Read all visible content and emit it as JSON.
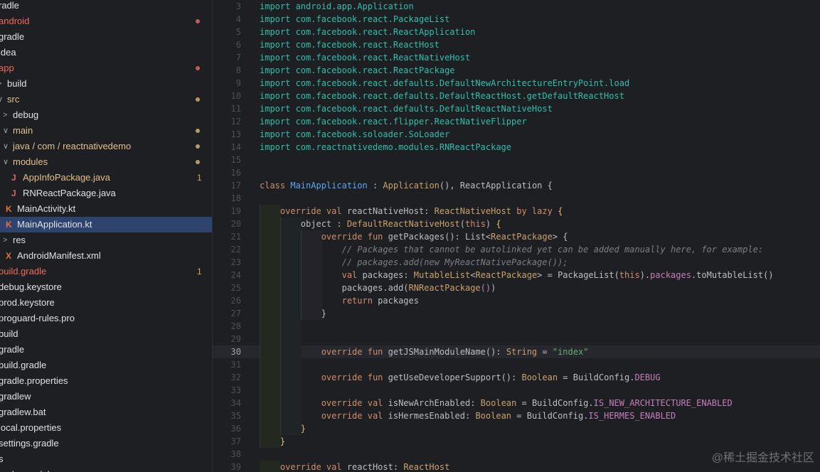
{
  "colors": {
    "kw": "#cf8e6d",
    "cls": "#bcbec4",
    "def": "#56a8f5",
    "str": "#6aab73",
    "cmt": "#7a7e85",
    "con": "#c77dbb",
    "typ": "#c9a26d",
    "imp": "#2fbfae",
    "purple": "#9876aa",
    "fld": "#c77dbb",
    "mod": "#58a6ff",
    "br": "#e8bf6a",
    "red": "#ee6a5f",
    "yellow": "#e2c08d",
    "white": "#dfe1e5",
    "dot_red": "#c55a5a",
    "dot_yellow": "#b79a5e"
  },
  "sidebar": {
    "items": [
      {
        "label": "radle",
        "chevron": "",
        "icon": "",
        "indent": 0,
        "color": "white"
      },
      {
        "label": "android",
        "chevron": "",
        "icon": "",
        "indent": 0,
        "color": "red",
        "dot": "dot_red"
      },
      {
        "label": "gradle",
        "chevron": "",
        "icon": "",
        "indent": 0,
        "color": "white"
      },
      {
        "label": "idea",
        "chevron": "",
        "icon": "",
        "indent": 0,
        "color": "white"
      },
      {
        "label": "app",
        "chevron": "",
        "icon": "",
        "indent": 0,
        "color": "red",
        "dot": "dot_red"
      },
      {
        "label": "build",
        "chevron": ">",
        "icon": "",
        "indent": 0,
        "color": "white"
      },
      {
        "label": "src",
        "chevron": "∨",
        "icon": "",
        "indent": 0,
        "color": "yellow",
        "dot": "dot_yellow"
      },
      {
        "label": "debug",
        "chevron": ">",
        "icon": "",
        "indent": 1,
        "color": "white"
      },
      {
        "label": "main",
        "chevron": "∨",
        "icon": "",
        "indent": 1,
        "color": "yellow",
        "dot": "dot_yellow"
      },
      {
        "label": "java / com / reactnativedemo",
        "chevron": "∨",
        "icon": "",
        "indent": 1,
        "color": "yellow",
        "dot": "dot_yellow"
      },
      {
        "label": "modules",
        "chevron": "∨",
        "icon": "",
        "indent": 1,
        "color": "yellow",
        "dot": "dot_yellow"
      },
      {
        "label": "AppInfoPackage.java",
        "chevron": "",
        "icon": "J",
        "indent": 2,
        "color": "yellow",
        "count": "1"
      },
      {
        "label": "RNReactPackage.java",
        "chevron": "",
        "icon": "J",
        "indent": 2,
        "color": "white"
      },
      {
        "label": "MainActivity.kt",
        "chevron": "",
        "icon": "K",
        "indent": 1,
        "color": "white"
      },
      {
        "label": "MainApplication.kt",
        "chevron": "",
        "icon": "K",
        "indent": 1,
        "color": "white",
        "selected": true
      },
      {
        "label": "res",
        "chevron": ">",
        "icon": "",
        "indent": 1,
        "color": "white"
      },
      {
        "label": "AndroidManifest.xml",
        "chevron": "",
        "icon": "X",
        "indent": 1,
        "color": "white"
      },
      {
        "label": "build.gradle",
        "chevron": "",
        "icon": "",
        "indent": 0,
        "color": "red",
        "count": "1"
      },
      {
        "label": "debug.keystore",
        "chevron": "",
        "icon": "",
        "indent": 0,
        "color": "white"
      },
      {
        "label": "prod.keystore",
        "chevron": "",
        "icon": "",
        "indent": 0,
        "color": "white"
      },
      {
        "label": "proguard-rules.pro",
        "chevron": "",
        "icon": "",
        "indent": 0,
        "color": "white"
      },
      {
        "label": "build",
        "chevron": "",
        "icon": "",
        "indent": 0,
        "color": "white"
      },
      {
        "label": "gradle",
        "chevron": "",
        "icon": "",
        "indent": 0,
        "color": "white"
      },
      {
        "label": "build.gradle",
        "chevron": "",
        "icon": "",
        "indent": 0,
        "color": "white"
      },
      {
        "label": "gradle.properties",
        "chevron": "",
        "icon": "",
        "indent": 0,
        "color": "white"
      },
      {
        "label": "gradlew",
        "chevron": "",
        "icon": "",
        "indent": 0,
        "color": "white"
      },
      {
        "label": "gradlew.bat",
        "chevron": "",
        "icon": "",
        "indent": 0,
        "color": "white"
      },
      {
        "label": "local.properties",
        "chevron": "",
        "icon": "",
        "indent": 0,
        "color": "white"
      },
      {
        "label": "settings.gradle",
        "chevron": "",
        "icon": "",
        "indent": 0,
        "color": "white"
      },
      {
        "label": "s",
        "chevron": "",
        "icon": "",
        "indent": 0,
        "color": "white"
      },
      {
        "label": "node_modules",
        "chevron": "",
        "icon": "",
        "indent": 0,
        "color": "white"
      }
    ]
  },
  "editor": {
    "current_line": 30,
    "lines": [
      {
        "n": 3,
        "segs": [
          [
            "import android.app.Application",
            "imp"
          ]
        ]
      },
      {
        "n": 4,
        "segs": [
          [
            "import com.facebook.react.PackageList",
            "imp"
          ]
        ]
      },
      {
        "n": 5,
        "segs": [
          [
            "import com.facebook.react.ReactApplication",
            "imp"
          ]
        ]
      },
      {
        "n": 6,
        "segs": [
          [
            "import com.facebook.react.ReactHost",
            "imp"
          ]
        ]
      },
      {
        "n": 7,
        "segs": [
          [
            "import com.facebook.react.ReactNativeHost",
            "imp"
          ]
        ]
      },
      {
        "n": 8,
        "segs": [
          [
            "import com.facebook.react.ReactPackage",
            "imp"
          ]
        ]
      },
      {
        "n": 9,
        "segs": [
          [
            "import com.facebook.react.defaults.DefaultNewArchitectureEntryPoint.load",
            "imp"
          ]
        ]
      },
      {
        "n": 10,
        "segs": [
          [
            "import com.facebook.react.defaults.DefaultReactHost.getDefaultReactHost",
            "imp"
          ]
        ]
      },
      {
        "n": 11,
        "segs": [
          [
            "import com.facebook.react.defaults.DefaultReactNativeHost",
            "imp"
          ]
        ]
      },
      {
        "n": 12,
        "segs": [
          [
            "import com.facebook.react.flipper.ReactNativeFlipper",
            "imp"
          ]
        ]
      },
      {
        "n": 13,
        "segs": [
          [
            "import com.facebook.soloader.SoLoader",
            "imp"
          ]
        ]
      },
      {
        "n": 14,
        "segs": [
          [
            "import com.reactnativedemo.modules.RNReactPackage",
            "imp"
          ]
        ]
      },
      {
        "n": 15,
        "segs": []
      },
      {
        "n": 16,
        "segs": []
      },
      {
        "n": 17,
        "segs": [
          [
            "class ",
            "kw"
          ],
          [
            "MainApplication",
            "def"
          ],
          [
            " : ",
            "cls"
          ],
          [
            "Application",
            "typ"
          ],
          [
            "(), ",
            "cls"
          ],
          [
            "ReactApplication",
            "cls"
          ],
          [
            " {",
            "cls"
          ]
        ]
      },
      {
        "n": 18,
        "segs": []
      },
      {
        "n": 19,
        "segs": [
          [
            "    override val ",
            "kw"
          ],
          [
            "reactNativeHost",
            "cls"
          ],
          [
            ": ",
            "cls"
          ],
          [
            "ReactNativeHost",
            "typ"
          ],
          [
            " by lazy ",
            "kw"
          ],
          [
            "{",
            "br"
          ]
        ]
      },
      {
        "n": 20,
        "segs": [
          [
            "        object : ",
            "cls"
          ],
          [
            "DefaultReactNativeHost",
            "typ"
          ],
          [
            "(",
            "cls"
          ],
          [
            "this",
            "kw"
          ],
          [
            ") ",
            "cls"
          ],
          [
            "{",
            "br"
          ]
        ]
      },
      {
        "n": 21,
        "segs": [
          [
            "            override fun ",
            "kw"
          ],
          [
            "getPackages",
            "cls"
          ],
          [
            "(): ",
            "cls"
          ],
          [
            "List",
            "cls"
          ],
          [
            "<",
            "cls"
          ],
          [
            "ReactPackage",
            "typ"
          ],
          [
            "> {",
            "cls"
          ]
        ]
      },
      {
        "n": 22,
        "segs": [
          [
            "                // Packages that cannot be autolinked yet can be added manually here, for example:",
            "cmt"
          ]
        ]
      },
      {
        "n": 23,
        "segs": [
          [
            "                // packages.add(new MyReactNativePackage());",
            "cmt"
          ]
        ]
      },
      {
        "n": 24,
        "segs": [
          [
            "                val ",
            "kw"
          ],
          [
            "packages",
            "cls"
          ],
          [
            ": ",
            "cls"
          ],
          [
            "MutableList",
            "typ"
          ],
          [
            "<",
            "cls"
          ],
          [
            "ReactPackage",
            "typ"
          ],
          [
            "> = ",
            "cls"
          ],
          [
            "PackageList",
            "cls"
          ],
          [
            "(",
            "cls"
          ],
          [
            "this",
            "kw"
          ],
          [
            ").",
            "cls"
          ],
          [
            "packages",
            "fld"
          ],
          [
            ".toMutableList()",
            "cls"
          ]
        ]
      },
      {
        "n": 25,
        "segs": [
          [
            "                packages.add(",
            "cls"
          ],
          [
            "RNReactPackage",
            "typ"
          ],
          [
            "()",
            "fld"
          ],
          [
            ")",
            "cls"
          ]
        ]
      },
      {
        "n": 26,
        "segs": [
          [
            "                return ",
            "kw"
          ],
          [
            "packages",
            "cls"
          ]
        ]
      },
      {
        "n": 27,
        "segs": [
          [
            "            }",
            "cls"
          ]
        ]
      },
      {
        "n": 28,
        "segs": []
      },
      {
        "n": 29,
        "segs": []
      },
      {
        "n": 30,
        "segs": [
          [
            "            override fun ",
            "kw"
          ],
          [
            "getJSMainModuleName",
            "cls"
          ],
          [
            "(): ",
            "cls"
          ],
          [
            "String",
            "typ"
          ],
          [
            " = ",
            "cls"
          ],
          [
            "\"index\"",
            "str"
          ]
        ]
      },
      {
        "n": 31,
        "segs": []
      },
      {
        "n": 32,
        "segs": [
          [
            "            override fun ",
            "kw"
          ],
          [
            "getUseDeveloperSupport",
            "cls"
          ],
          [
            "(): ",
            "cls"
          ],
          [
            "Boolean",
            "typ"
          ],
          [
            " = ",
            "cls"
          ],
          [
            "BuildConfig.",
            "cls"
          ],
          [
            "DEBUG",
            "con"
          ]
        ]
      },
      {
        "n": 33,
        "segs": []
      },
      {
        "n": 34,
        "segs": [
          [
            "            override val ",
            "kw"
          ],
          [
            "isNewArchEnabled",
            "cls"
          ],
          [
            ": ",
            "cls"
          ],
          [
            "Boolean",
            "typ"
          ],
          [
            " = ",
            "cls"
          ],
          [
            "BuildConfig.",
            "cls"
          ],
          [
            "IS_NEW_ARCHITECTURE_ENABLED",
            "con"
          ]
        ]
      },
      {
        "n": 35,
        "segs": [
          [
            "            override val ",
            "kw"
          ],
          [
            "isHermesEnabled",
            "cls"
          ],
          [
            ": ",
            "cls"
          ],
          [
            "Boolean",
            "typ"
          ],
          [
            " = ",
            "cls"
          ],
          [
            "BuildConfig.",
            "cls"
          ],
          [
            "IS_HERMES_ENABLED",
            "con"
          ]
        ]
      },
      {
        "n": 36,
        "segs": [
          [
            "        }",
            "br"
          ]
        ]
      },
      {
        "n": 37,
        "segs": [
          [
            "    }",
            "br"
          ]
        ]
      },
      {
        "n": 38,
        "segs": []
      },
      {
        "n": 39,
        "segs": [
          [
            "    override val ",
            "kw"
          ],
          [
            "reactHost",
            "cls"
          ],
          [
            ": ",
            "cls"
          ],
          [
            "ReactHost",
            "typ"
          ]
        ]
      }
    ]
  },
  "watermark": "@稀土掘金技术社区"
}
